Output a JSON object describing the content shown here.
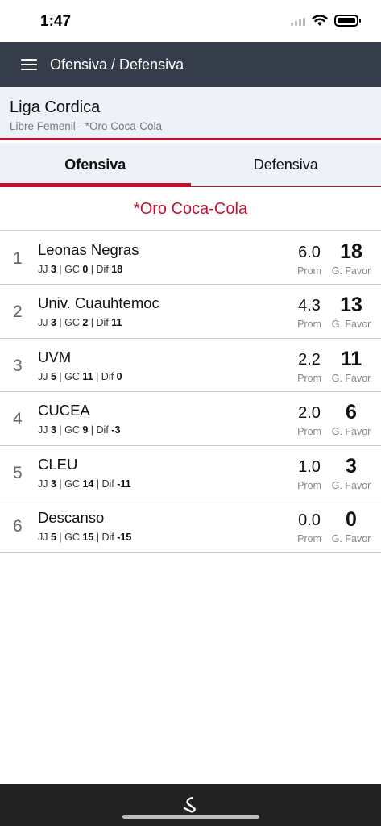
{
  "status": {
    "time": "1:47"
  },
  "app_bar": {
    "title": "Ofensiva / Defensiva"
  },
  "league": {
    "name": "Liga Cordica",
    "subtitle": "Libre Femenil - *Oro Coca-Cola"
  },
  "tabs": [
    {
      "label": "Ofensiva",
      "active": true
    },
    {
      "label": "Defensiva",
      "active": false
    }
  ],
  "group": {
    "title": "*Oro Coca-Cola"
  },
  "labels": {
    "jj": "JJ",
    "gc": "GC",
    "dif": "Dif",
    "prom": "Prom",
    "g_favor": "G. Favor"
  },
  "teams": [
    {
      "rank": "1",
      "name": "Leonas Negras",
      "jj": "3",
      "gc": "0",
      "dif": "18",
      "prom": "6.0",
      "gf": "18"
    },
    {
      "rank": "2",
      "name": "Univ. Cuauhtemoc",
      "jj": "3",
      "gc": "2",
      "dif": "11",
      "prom": "4.3",
      "gf": "13"
    },
    {
      "rank": "3",
      "name": "UVM",
      "jj": "5",
      "gc": "11",
      "dif": "0",
      "prom": "2.2",
      "gf": "11"
    },
    {
      "rank": "4",
      "name": "CUCEA",
      "jj": "3",
      "gc": "9",
      "dif": "-3",
      "prom": "2.0",
      "gf": "6"
    },
    {
      "rank": "5",
      "name": "CLEU",
      "jj": "3",
      "gc": "14",
      "dif": "-11",
      "prom": "1.0",
      "gf": "3"
    },
    {
      "rank": "6",
      "name": "Descanso",
      "jj": "5",
      "gc": "15",
      "dif": "-15",
      "prom": "0.0",
      "gf": "0"
    }
  ],
  "colors": {
    "accent": "#c8102e",
    "app_bar": "#353d4a",
    "header_bg": "#eef1f7",
    "bottom_bar": "#222222"
  },
  "icons": {
    "menu": "hamburger-menu-icon",
    "wifi": "wifi-icon",
    "battery": "battery-icon",
    "signal": "signal-icon",
    "logo": "app-logo-icon"
  }
}
